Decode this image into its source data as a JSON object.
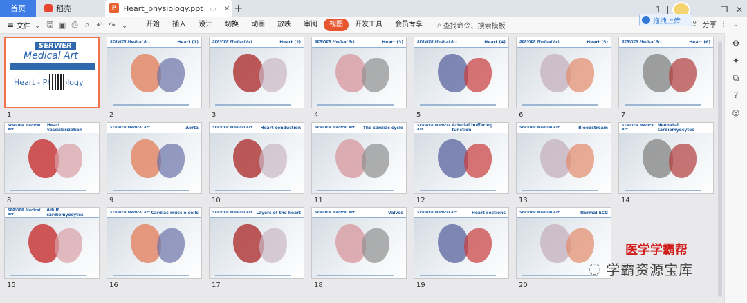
{
  "tabs": {
    "home": "首页",
    "docer": "稻壳",
    "active_file": "Heart_physiology.ppt"
  },
  "toolbar": {
    "file_menu": "文件",
    "menus": [
      "开始",
      "插入",
      "设计",
      "切换",
      "动画",
      "放映",
      "审阅",
      "视图",
      "开发工具",
      "会员专享"
    ],
    "active_menu": "视图",
    "search_placeholder": "查找命令、搜索模板",
    "upload_label": "拖拽上传",
    "share_label": "分享",
    "page_badge": "1"
  },
  "slides": [
    {
      "n": "1",
      "title": "Heart - Physiology",
      "cover": true
    },
    {
      "n": "2",
      "title": "Heart (1)"
    },
    {
      "n": "3",
      "title": "Heart (2)"
    },
    {
      "n": "4",
      "title": "Heart (3)"
    },
    {
      "n": "5",
      "title": "Heart (4)"
    },
    {
      "n": "6",
      "title": "Heart (5)"
    },
    {
      "n": "7",
      "title": "Heart (6)"
    },
    {
      "n": "8",
      "title": "Heart vascularization"
    },
    {
      "n": "9",
      "title": "Aorta"
    },
    {
      "n": "10",
      "title": "Heart conduction"
    },
    {
      "n": "11",
      "title": "The cardiac cycle"
    },
    {
      "n": "12",
      "title": "Arterial buffering function"
    },
    {
      "n": "13",
      "title": "Bloodstream"
    },
    {
      "n": "14",
      "title": "Neonatal cardiomyocytes"
    },
    {
      "n": "15",
      "title": "Adult cardiomyocytes"
    },
    {
      "n": "16",
      "title": "Cardiac muscle cells"
    },
    {
      "n": "17",
      "title": "Layers of the heart"
    },
    {
      "n": "18",
      "title": "Valves"
    },
    {
      "n": "19",
      "title": "Heart sections"
    },
    {
      "n": "20",
      "title": "Normal ECG"
    }
  ],
  "cover": {
    "brand_top": "SERVIER",
    "brand_bottom": "Medical Art"
  },
  "slide_brand": "SERVIER Medical Art",
  "watermark": {
    "line1": "医学学霸帮",
    "line2": "学霸资源宝库"
  },
  "colors": {
    "accent": "#e8562f",
    "home_tab": "#3d7de5",
    "brand_blue": "#2f68ad"
  }
}
